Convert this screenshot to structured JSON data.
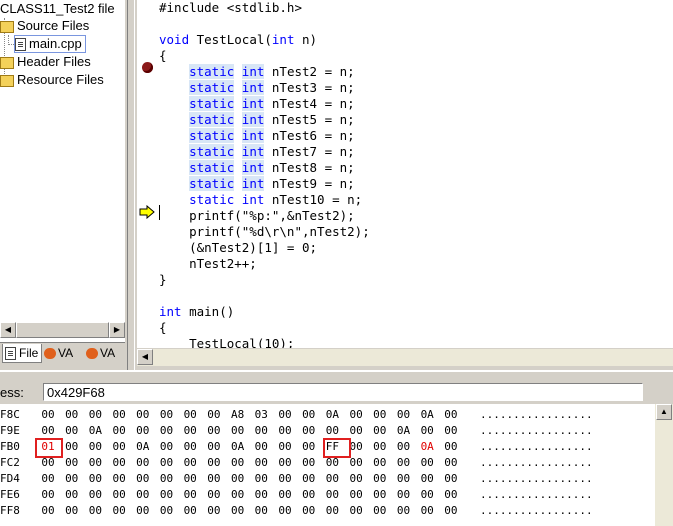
{
  "file_tree": {
    "project_label": "CLASS11_Test2 file",
    "items": [
      {
        "label": "Source Files",
        "type": "folder"
      },
      {
        "label": "main.cpp",
        "type": "file"
      },
      {
        "label": "Header Files",
        "type": "folder"
      },
      {
        "label": "Resource Files",
        "type": "folder"
      }
    ]
  },
  "workspace_tabs": [
    {
      "label": "File",
      "icon": "file-view-icon"
    },
    {
      "label": "VA",
      "icon": "va-icon"
    },
    {
      "label": "VA",
      "icon": "va-icon"
    }
  ],
  "code_lines": [
    "#include <stdlib.h>",
    "",
    "void TestLocal(int n)",
    "{",
    "    static int nTest2 = n;",
    "    static int nTest3 = n;",
    "    static int nTest4 = n;",
    "    static int nTest5 = n;",
    "    static int nTest6 = n;",
    "    static int nTest7 = n;",
    "    static int nTest8 = n;",
    "    static int nTest9 = n;",
    "    static int nTest10 = n;",
    "    printf(\"%p:\",&nTest2);",
    "    printf(\"%d\\r\\n\",nTest2);",
    "    (&nTest2)[1] = 0;",
    "    nTest2++;",
    "}",
    "",
    "int main()",
    "{",
    "    TestLocal(10);"
  ],
  "memory": {
    "address_label": "ess:",
    "address_value": "0x429F68",
    "rows": [
      {
        "addr": "F8C",
        "bytes": [
          "00",
          "00",
          "00",
          "00",
          "00",
          "00",
          "00",
          "00",
          "A8",
          "03",
          "00",
          "00",
          "0A",
          "00",
          "00",
          "00",
          "0A",
          "00"
        ],
        "ascii": "................."
      },
      {
        "addr": "F9E",
        "bytes": [
          "00",
          "00",
          "0A",
          "00",
          "00",
          "00",
          "00",
          "00",
          "00",
          "00",
          "00",
          "00",
          "00",
          "00",
          "00",
          "0A",
          "00",
          "00"
        ],
        "ascii": "................."
      },
      {
        "addr": "FB0",
        "bytes": [
          "01",
          "00",
          "00",
          "00",
          "0A",
          "00",
          "00",
          "00",
          "0A",
          "00",
          "00",
          "00",
          "FF",
          "00",
          "00",
          "00",
          "0A",
          "00"
        ],
        "ascii": "................."
      },
      {
        "addr": "FC2",
        "bytes": [
          "00",
          "00",
          "00",
          "00",
          "00",
          "00",
          "00",
          "00",
          "00",
          "00",
          "00",
          "00",
          "00",
          "00",
          "00",
          "00",
          "00",
          "00"
        ],
        "ascii": "................."
      },
      {
        "addr": "FD4",
        "bytes": [
          "00",
          "00",
          "00",
          "00",
          "00",
          "00",
          "00",
          "00",
          "00",
          "00",
          "00",
          "00",
          "00",
          "00",
          "00",
          "00",
          "00",
          "00"
        ],
        "ascii": "................."
      },
      {
        "addr": "FE6",
        "bytes": [
          "00",
          "00",
          "00",
          "00",
          "00",
          "00",
          "00",
          "00",
          "00",
          "00",
          "00",
          "00",
          "00",
          "00",
          "00",
          "00",
          "00",
          "00"
        ],
        "ascii": "................."
      },
      {
        "addr": "FF8",
        "bytes": [
          "00",
          "00",
          "00",
          "00",
          "00",
          "00",
          "00",
          "00",
          "00",
          "00",
          "00",
          "00",
          "00",
          "00",
          "00",
          "00",
          "00",
          "00"
        ],
        "ascii": "................."
      }
    ]
  },
  "colors": {
    "keyword": "#0000ff",
    "highlight": "#d8e6f6",
    "annotation_box": "#e02020",
    "changed_byte": "#e00000"
  }
}
